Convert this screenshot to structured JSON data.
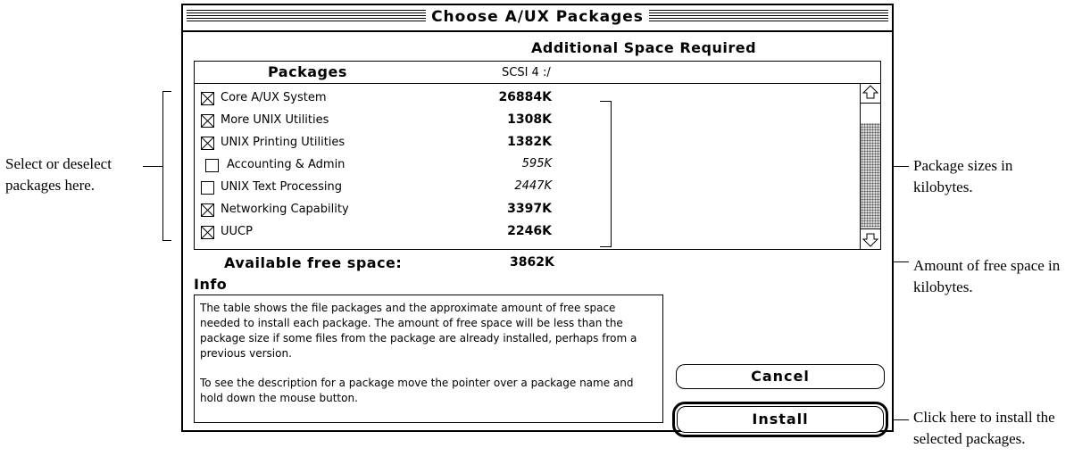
{
  "dialog": {
    "title": "Choose A/UX Packages",
    "space_header": "Additional Space Required",
    "packages_header": "Packages",
    "disk": "SCSI 4 :/",
    "packages": [
      {
        "name": "Core A/UX System",
        "size": "26884K",
        "checked": true
      },
      {
        "name": "More UNIX Utilities",
        "size": "1308K",
        "checked": true
      },
      {
        "name": "UNIX Printing Utilities",
        "size": "1382K",
        "checked": true
      },
      {
        "name": "Accounting & Admin",
        "size": "595K",
        "checked": false
      },
      {
        "name": "UNIX Text Processing",
        "size": "2447K",
        "checked": false
      },
      {
        "name": "Networking Capability",
        "size": "3397K",
        "checked": true
      },
      {
        "name": "UUCP",
        "size": "2246K",
        "checked": true
      }
    ],
    "free_space_label": "Available free space:",
    "free_space_value": "3862K",
    "info_label": "Info",
    "info_text_1": "The table shows the file packages and the approximate amount of free space needed to install each package.  The amount of free space will be less than the package size if some files from the package are already installed, perhaps from a previous version.",
    "info_text_2": "To see the description for a package move the pointer over a package name and hold down the mouse button.",
    "cancel_label": "Cancel",
    "install_label": "Install"
  },
  "annotations": {
    "select": "Select or deselect packages here.",
    "sizes": "Package sizes in kilobytes.",
    "free": "Amount of free space in kilobytes.",
    "install": "Click here to install the selected packages."
  },
  "icons": [
    "checkbox-checked-icon",
    "checkbox-empty-icon",
    "scroll-up-arrow-icon",
    "scroll-down-arrow-icon"
  ]
}
